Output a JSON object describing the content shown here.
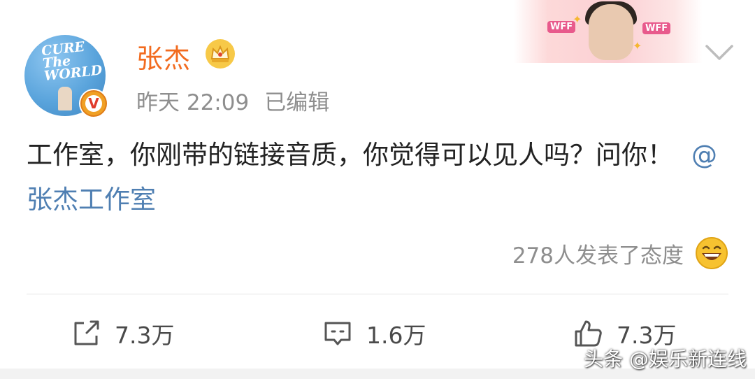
{
  "post": {
    "author": "张杰",
    "time": "昨天 22:09",
    "edited": "已编辑",
    "text": "工作室，你刚带的链接音质，你觉得可以见人吗？问你！",
    "mention": "@张杰工作室",
    "reactions_text": "278人发表了态度",
    "avatar_text": "CURE\nThe\nWORLD",
    "verified_badge": "V"
  },
  "banner": {
    "tag": "WFF"
  },
  "actions": {
    "repost_count": "7.3万",
    "comment_count": "1.6万",
    "like_count": "7.3万"
  },
  "watermark": "头条 @娱乐新连线",
  "colors": {
    "author": "#f26b1f",
    "mention": "#4f7fb2",
    "meta": "#8e8e8e"
  },
  "icons": {
    "crown": "crown-icon",
    "dropdown": "chevron-down-icon",
    "reaction": "grin-icon",
    "repost": "repost-icon",
    "comment": "comment-icon",
    "like": "thumbs-up-icon"
  }
}
